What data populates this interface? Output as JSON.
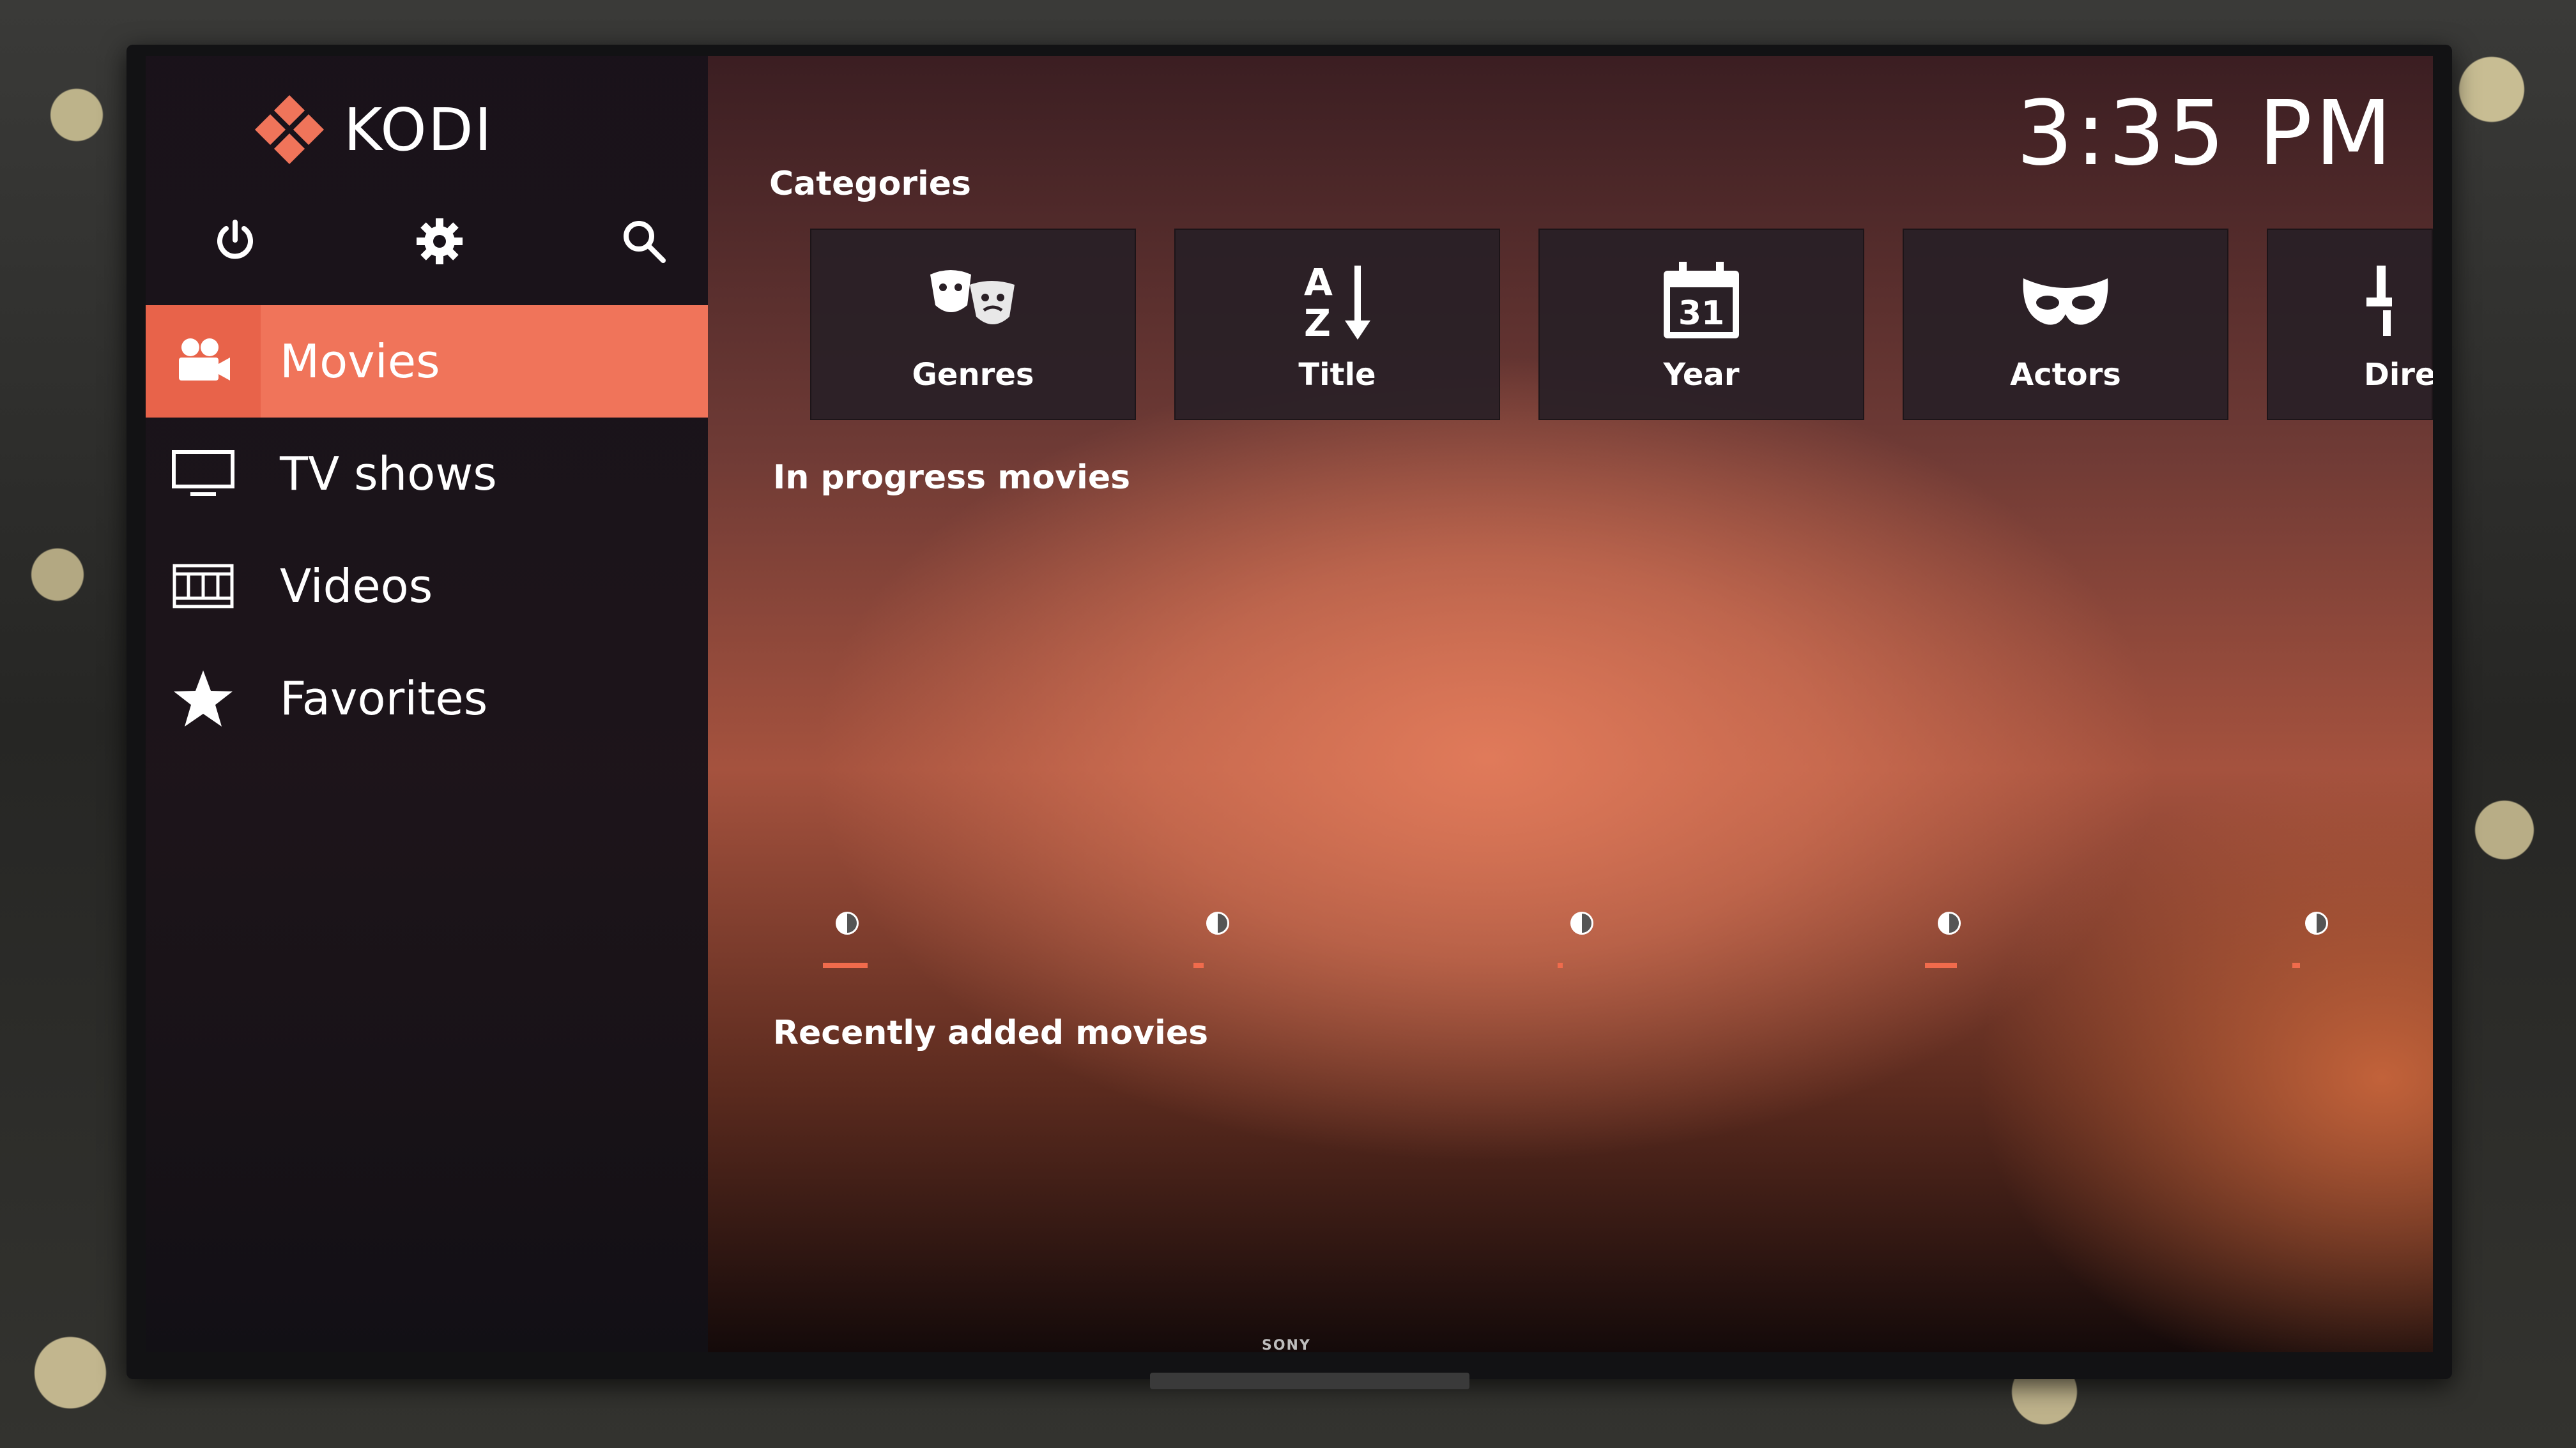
{
  "app": {
    "name": "KODI",
    "clock": "3:35 PM"
  },
  "tv": {
    "brand": "SONY"
  },
  "top_icons": [
    "power-icon",
    "settings-icon",
    "search-icon"
  ],
  "sidebar": {
    "items": [
      {
        "label": "Movies",
        "icon": "movie-camera-icon",
        "active": true
      },
      {
        "label": "TV shows",
        "icon": "tv-icon",
        "active": false
      },
      {
        "label": "Videos",
        "icon": "film-strip-icon",
        "active": false
      },
      {
        "label": "Favorites",
        "icon": "star-icon",
        "active": false
      }
    ]
  },
  "sections": {
    "categories": "Categories",
    "in_progress": "In progress movies",
    "recently_added": "Recently added movies"
  },
  "categories": [
    {
      "label": "Genres",
      "icon": "theater-masks-icon"
    },
    {
      "label": "Title",
      "icon": "sort-az-icon"
    },
    {
      "label": "Year",
      "icon": "calendar-icon",
      "icon_text": "31"
    },
    {
      "label": "Actors",
      "icon": "mask-icon"
    },
    {
      "label": "Dire",
      "icon": "director-icon"
    }
  ],
  "in_progress_items": [
    {
      "progress": 0.35
    },
    {
      "progress": 0.08
    },
    {
      "progress": 0.04
    },
    {
      "progress": 0.25
    },
    {
      "progress": 0.06
    }
  ],
  "colors": {
    "accent": "#f0745a",
    "sidebar_bg": "#18121a"
  }
}
